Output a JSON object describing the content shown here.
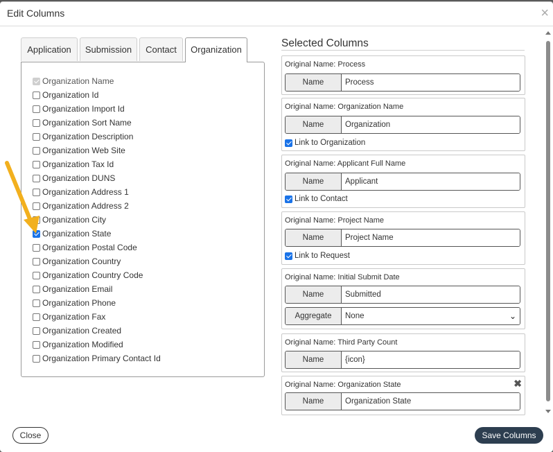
{
  "dialog": {
    "title": "Edit Columns",
    "close_symbol": "×"
  },
  "tabs": [
    {
      "label": "Application",
      "active": false
    },
    {
      "label": "Submission",
      "active": false
    },
    {
      "label": "Contact",
      "active": false
    },
    {
      "label": "Organization",
      "active": true
    }
  ],
  "fields": [
    {
      "label": "Organization Name",
      "checked": true,
      "disabled": true
    },
    {
      "label": "Organization Id",
      "checked": false
    },
    {
      "label": "Organization Import Id",
      "checked": false
    },
    {
      "label": "Organization Sort Name",
      "checked": false
    },
    {
      "label": "Organization Description",
      "checked": false
    },
    {
      "label": "Organization Web Site",
      "checked": false
    },
    {
      "label": "Organization Tax Id",
      "checked": false
    },
    {
      "label": "Organization DUNS",
      "checked": false
    },
    {
      "label": "Organization Address 1",
      "checked": false
    },
    {
      "label": "Organization Address 2",
      "checked": false
    },
    {
      "label": "Organization City",
      "checked": false
    },
    {
      "label": "Organization State",
      "checked": true
    },
    {
      "label": "Organization Postal Code",
      "checked": false
    },
    {
      "label": "Organization Country",
      "checked": false
    },
    {
      "label": "Organization Country Code",
      "checked": false
    },
    {
      "label": "Organization Email",
      "checked": false
    },
    {
      "label": "Organization Phone",
      "checked": false
    },
    {
      "label": "Organization Fax",
      "checked": false
    },
    {
      "label": "Organization Created",
      "checked": false
    },
    {
      "label": "Organization Modified",
      "checked": false
    },
    {
      "label": "Organization Primary Contact Id",
      "checked": false
    }
  ],
  "selected": {
    "heading": "Selected Columns",
    "name_label": "Name",
    "aggregate_label": "Aggregate",
    "remove_symbol": "✖",
    "columns": [
      {
        "original": "Original Name: Process",
        "name": "Process"
      },
      {
        "original": "Original Name: Organization Name",
        "name": "Organization",
        "link_label": "Link to Organization",
        "link_checked": true
      },
      {
        "original": "Original Name: Applicant Full Name",
        "name": "Applicant",
        "link_label": "Link to Contact",
        "link_checked": true
      },
      {
        "original": "Original Name: Project Name",
        "name": "Project Name",
        "link_label": "Link to Request",
        "link_checked": true
      },
      {
        "original": "Original Name: Initial Submit Date",
        "name": "Submitted",
        "aggregate_value": "None"
      },
      {
        "original": "Original Name: Third Party Count",
        "name": "{icon}"
      },
      {
        "original": "Original Name: Organization State",
        "name": "Organization State",
        "removable": true
      }
    ]
  },
  "footer": {
    "close_label": "Close",
    "save_label": "Save Columns"
  },
  "colors": {
    "save_button": "#2d3e50",
    "checkbox": "#1a73e8",
    "arrow": "#f2b01e"
  }
}
